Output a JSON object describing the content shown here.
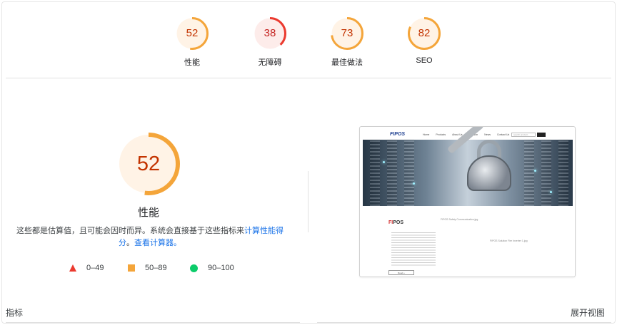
{
  "scores": [
    {
      "label": "性能",
      "value": "52",
      "fraction": 0.52,
      "color": "#f4a53a",
      "text_color": "#c33300",
      "bg": "#fff3e6"
    },
    {
      "label": "无障碍",
      "value": "38",
      "fraction": 0.38,
      "color": "#eb3a2f",
      "text_color": "#c5221f",
      "bg": "#fdecea"
    },
    {
      "label": "最佳做法",
      "value": "73",
      "fraction": 0.73,
      "color": "#f4a53a",
      "text_color": "#c33300",
      "bg": "#fff3e6"
    },
    {
      "label": "SEO",
      "value": "82",
      "fraction": 0.82,
      "color": "#f4a53a",
      "text_color": "#c33300",
      "bg": "#fff3e6"
    }
  ],
  "main": {
    "value": "52",
    "fraction": 0.52,
    "title": "性能",
    "desc_text": "这些都是估算值，且可能会因时而异。系统会直接基于这些指标来",
    "desc_link1": "计算性能得分",
    "desc_sep": "。",
    "desc_link2": "查看计算器。"
  },
  "legend": {
    "red": "0–49",
    "orange": "50–89",
    "green": "90–100"
  },
  "thumbnail": {
    "logo": "FIPOS",
    "nav": [
      "Home",
      "Products",
      "About Us",
      "Solution",
      "News",
      "Contact Us"
    ],
    "search_placeholder": "search product...",
    "brand_red": "FI",
    "brand_rest": "POS",
    "img_placeholder1": "FIPOS Safety Communication.jpg",
    "img_placeholder2": "FIPOS Solution Fire Inverter 1.jpg",
    "more_label": "Read +"
  },
  "footer": {
    "metrics_label": "指标",
    "expand_label": "展开视图"
  }
}
